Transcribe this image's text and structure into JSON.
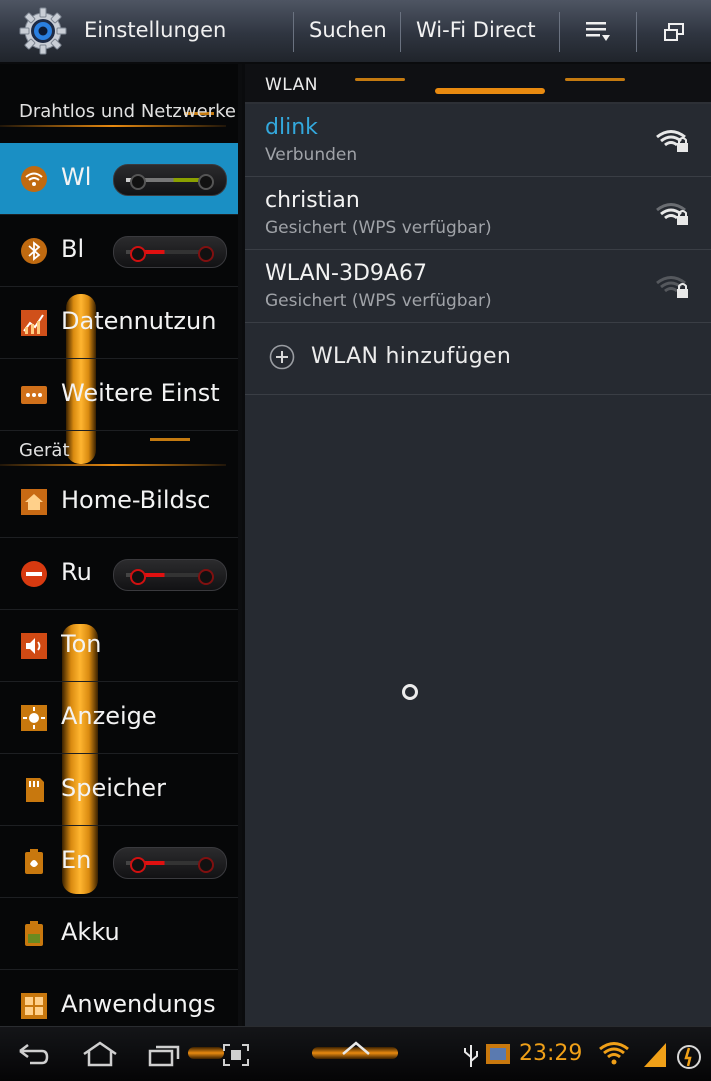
{
  "action_bar": {
    "title": "Einstellungen",
    "buttons": {
      "search": "Suchen",
      "wifi_direct": "Wi-Fi Direct"
    }
  },
  "sidebar": {
    "sections": [
      {
        "label": "Drahtlos und Netzwerke"
      },
      {
        "label": "Gerät"
      }
    ],
    "items": [
      {
        "label": "Wl",
        "icon": "wifi-icon",
        "switch": "on",
        "selected": true
      },
      {
        "label": "Bl",
        "icon": "bluetooth-icon",
        "switch": "off"
      },
      {
        "label": "Datennutzun",
        "icon": "data-usage-icon"
      },
      {
        "label": "Weitere Einst",
        "icon": "more-settings-icon"
      },
      {
        "label": "Home-Bildsc",
        "icon": "home-screen-icon"
      },
      {
        "label": "Ru",
        "icon": "do-not-disturb-icon",
        "switch": "off"
      },
      {
        "label": "Ton",
        "icon": "sound-icon"
      },
      {
        "label": "Anzeige",
        "icon": "display-icon"
      },
      {
        "label": "Speicher",
        "icon": "storage-icon"
      },
      {
        "label": "En",
        "icon": "power-saving-icon",
        "switch": "off"
      },
      {
        "label": "Akku",
        "icon": "battery-icon"
      },
      {
        "label": "Anwendungs",
        "icon": "apps-icon"
      }
    ]
  },
  "wlan": {
    "header": "WLAN",
    "networks": [
      {
        "name": "dlink",
        "status": "Verbunden",
        "connected": true,
        "signal": "strong"
      },
      {
        "name": "christian",
        "status": "Gesichert (WPS verfügbar)",
        "connected": false,
        "signal": "medium"
      },
      {
        "name": "WLAN-3D9A67",
        "status": "Gesichert (WPS verfügbar)",
        "connected": false,
        "signal": "weak"
      }
    ],
    "add_label": "WLAN hinzufügen"
  },
  "status_bar": {
    "time": "23:29"
  },
  "colors": {
    "accent_blue": "#1a8fc4",
    "connected_text": "#33a8dc",
    "orange": "#f0a018"
  }
}
